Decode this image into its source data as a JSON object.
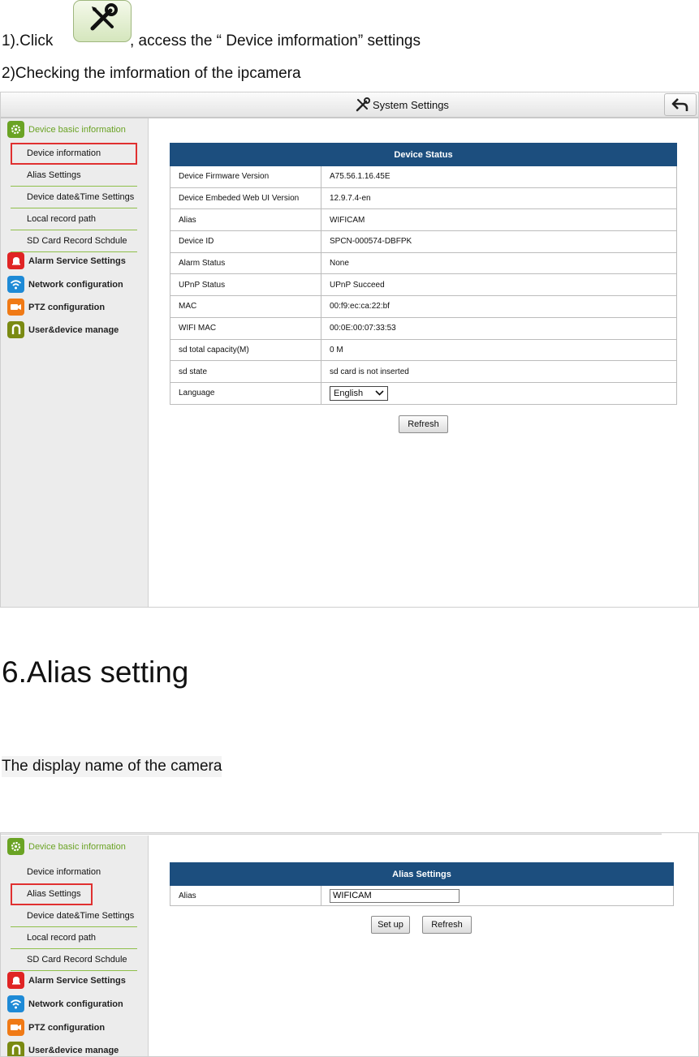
{
  "intro": {
    "step1_prefix": "1).Click",
    "step1_suffix": ", access the “ Device imformation” settings",
    "step2": "2)Checking the imformation of the ipcamera"
  },
  "screen1": {
    "title": "System Settings",
    "sidebar": {
      "group_basic": "Device basic information",
      "items": [
        "Device information",
        "Alias Settings",
        "Device date&Time Settings",
        "Local record path",
        "SD Card Record Schdule"
      ],
      "group_alarm": "Alarm Service Settings",
      "group_network": "Network configuration",
      "group_ptz": "PTZ configuration",
      "group_user": "User&device manage"
    },
    "table_title": "Device Status",
    "rows": [
      {
        "label": "Device Firmware Version",
        "value": "A75.56.1.16.45E"
      },
      {
        "label": "Device Embeded Web UI Version",
        "value": "12.9.7.4-en"
      },
      {
        "label": "Alias",
        "value": "WIFICAM"
      },
      {
        "label": "Device ID",
        "value": "SPCN-000574-DBFPK"
      },
      {
        "label": "Alarm Status",
        "value": "None"
      },
      {
        "label": "UPnP Status",
        "value": "UPnP Succeed"
      },
      {
        "label": "MAC",
        "value": "00:f9:ec:ca:22:bf"
      },
      {
        "label": "WIFI MAC",
        "value": "00:0E:00:07:33:53"
      },
      {
        "label": "sd total capacity(M)",
        "value": "0 M"
      },
      {
        "label": "sd state",
        "value": "sd card is not inserted"
      }
    ],
    "language_label": "Language",
    "language_value": "English",
    "refresh_label": "Refresh"
  },
  "section6": {
    "heading": "6.Alias setting",
    "description": "The display name of the camera"
  },
  "screen2": {
    "sidebar": {
      "group_basic": "Device basic information",
      "items": [
        "Device information",
        "Alias Settings",
        "Device date&Time Settings",
        "Local record path",
        "SD Card Record Schdule"
      ],
      "group_alarm": "Alarm Service Settings",
      "group_network": "Network configuration",
      "group_ptz": "PTZ configuration",
      "group_user": "User&device manage"
    },
    "table_title": "Alias Settings",
    "alias_label": "Alias",
    "alias_value": "WIFICAM",
    "setup_label": "Set up",
    "refresh_label": "Refresh"
  },
  "colors": {
    "header_blue": "#1c4e7e",
    "accent_green": "#6aa324",
    "highlight_red": "#e03030"
  }
}
